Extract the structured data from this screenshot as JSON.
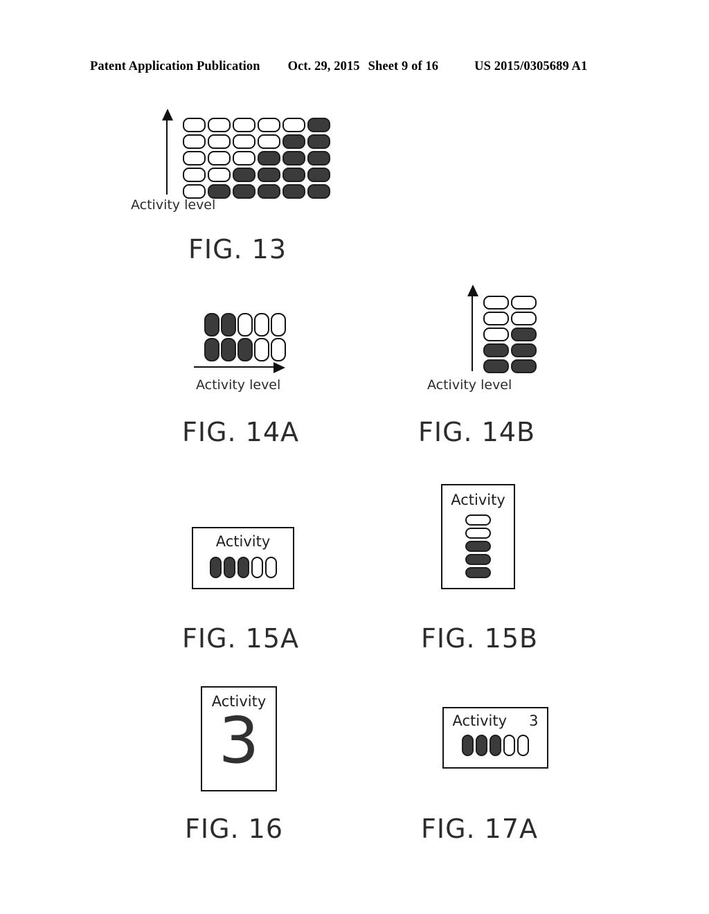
{
  "header": {
    "title": "Patent Application Publication",
    "date": "Oct. 29, 2015",
    "sheet": "Sheet 9 of 16",
    "publication_number": "US 2015/0305689 A1"
  },
  "figures": {
    "fig13": {
      "caption": "FIG. 13",
      "axis_label": "Activity level",
      "axis_direction": "vertical-up",
      "columns": 6,
      "rows": 5,
      "filled_per_row_top_to_bottom": [
        1,
        2,
        3,
        4,
        5
      ],
      "cells": [
        [
          0,
          0,
          0,
          0,
          0,
          1
        ],
        [
          0,
          0,
          0,
          0,
          1,
          1
        ],
        [
          0,
          0,
          0,
          1,
          1,
          1
        ],
        [
          0,
          0,
          1,
          1,
          1,
          1
        ],
        [
          0,
          1,
          1,
          1,
          1,
          1
        ]
      ]
    },
    "fig14a": {
      "caption": "FIG. 14A",
      "axis_label": "Activity level",
      "axis_direction": "horizontal-right",
      "columns": 5,
      "rows": 2,
      "cells": [
        [
          1,
          1,
          0,
          0,
          0
        ],
        [
          1,
          1,
          1,
          0,
          0
        ]
      ]
    },
    "fig14b": {
      "caption": "FIG. 14B",
      "axis_label": "Activity level",
      "axis_direction": "vertical-up",
      "columns": 2,
      "rows": 5,
      "cells": [
        [
          0,
          0
        ],
        [
          0,
          0
        ],
        [
          0,
          1
        ],
        [
          1,
          1
        ],
        [
          1,
          1
        ]
      ]
    },
    "fig15a": {
      "caption": "FIG. 15A",
      "box_label": "Activity",
      "orientation": "landscape",
      "segments": 5,
      "filled": 3,
      "cells": [
        1,
        1,
        1,
        0,
        0
      ]
    },
    "fig15b": {
      "caption": "FIG. 15B",
      "box_label": "Activity",
      "orientation": "portrait",
      "segments": 5,
      "filled": 3,
      "cells": [
        0,
        0,
        1,
        1,
        1
      ]
    },
    "fig16": {
      "caption": "FIG. 16",
      "box_label": "Activity",
      "orientation": "portrait",
      "value": "3"
    },
    "fig17a": {
      "caption": "FIG. 17A",
      "box_label": "Activity",
      "value": "3",
      "orientation": "landscape",
      "segments": 5,
      "filled": 3,
      "cells": [
        1,
        1,
        1,
        0,
        0
      ]
    }
  },
  "colors": {
    "ink": "#141414",
    "fill": "#3b3b3b",
    "paper": "#ffffff"
  }
}
